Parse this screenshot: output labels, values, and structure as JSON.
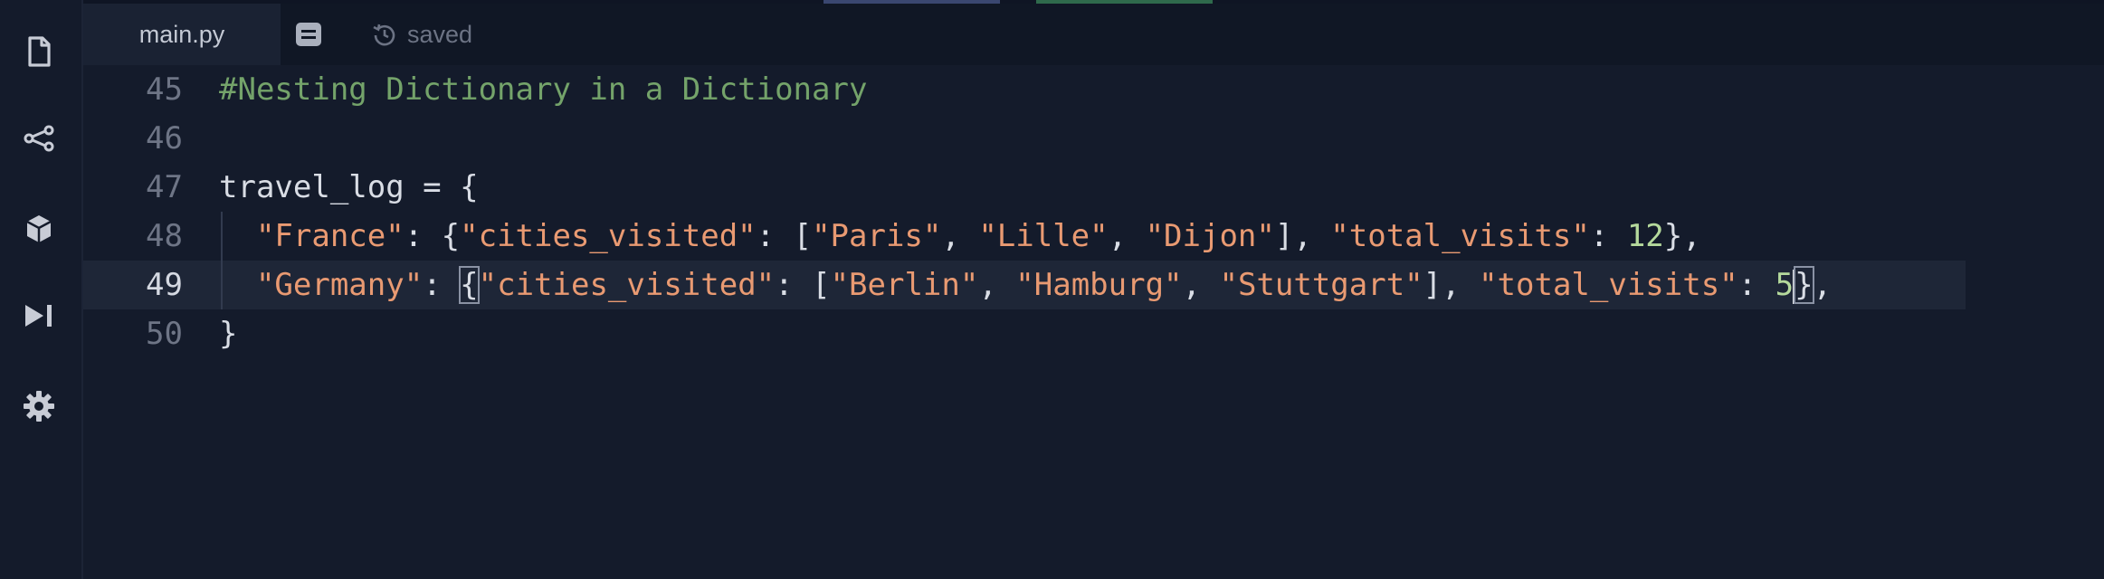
{
  "window": {
    "tab_title": "main.py",
    "save_status": "saved",
    "icons": {
      "files": "file-icon",
      "git": "share-nodes-icon",
      "packages": "cube-icon",
      "run": "run-icon",
      "settings": "gear-icon",
      "notes": "notes-icon",
      "history": "history-icon"
    }
  },
  "colors": {
    "background": "#141b2b",
    "comment": "#74a36a",
    "string": "#e99a72",
    "number": "#b5d99c",
    "text": "#d9dde5",
    "line_number": "#6e7586",
    "active_line": "#1e2637"
  },
  "editor": {
    "active_line": 49,
    "lines": [
      {
        "number": "45",
        "tokens": [
          {
            "t": "#Nesting Dictionary in a Dictionary",
            "c": "com"
          }
        ]
      },
      {
        "number": "46",
        "tokens": []
      },
      {
        "number": "47",
        "tokens": [
          {
            "t": "travel_log = {",
            "c": "txt"
          }
        ]
      },
      {
        "number": "48",
        "tokens": [
          {
            "t": "  "
          },
          {
            "t": "\"France\"",
            "c": "str"
          },
          {
            "t": ": {"
          },
          {
            "t": "\"cities_visited\"",
            "c": "str"
          },
          {
            "t": ": ["
          },
          {
            "t": "\"Paris\"",
            "c": "str"
          },
          {
            "t": ", "
          },
          {
            "t": "\"Lille\"",
            "c": "str"
          },
          {
            "t": ", "
          },
          {
            "t": "\"Dijon\"",
            "c": "str"
          },
          {
            "t": "], "
          },
          {
            "t": "\"total_visits\"",
            "c": "str"
          },
          {
            "t": ": "
          },
          {
            "t": "12",
            "c": "num"
          },
          {
            "t": "},"
          }
        ]
      },
      {
        "number": "49",
        "tokens": [
          {
            "t": "  "
          },
          {
            "t": "\"Germany\"",
            "c": "str"
          },
          {
            "t": ": "
          },
          {
            "t": "{",
            "hl": true
          },
          {
            "t": "\"cities_visited\"",
            "c": "str"
          },
          {
            "t": ": ["
          },
          {
            "t": "\"Berlin\"",
            "c": "str"
          },
          {
            "t": ", "
          },
          {
            "t": "\"Hamburg\"",
            "c": "str"
          },
          {
            "t": ", "
          },
          {
            "t": "\"Stuttgart\"",
            "c": "str"
          },
          {
            "t": "], "
          },
          {
            "t": "\"total_visits\"",
            "c": "str"
          },
          {
            "t": ": "
          },
          {
            "t": "5",
            "c": "num"
          },
          {
            "t": "",
            "cursor": true
          },
          {
            "t": "}",
            "hl": true
          },
          {
            "t": ","
          }
        ]
      },
      {
        "number": "50",
        "tokens": [
          {
            "t": "}",
            "c": "txt"
          }
        ]
      }
    ]
  }
}
